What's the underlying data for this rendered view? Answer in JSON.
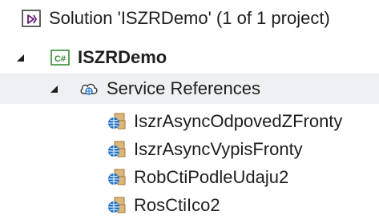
{
  "solution": {
    "label": "Solution 'ISZRDemo' (1 of 1 project)",
    "icon": "solution-icon"
  },
  "project": {
    "label": "ISZRDemo",
    "icon": "csharp-project-icon",
    "expanded": true
  },
  "service_references": {
    "label": "Service References",
    "icon": "service-references-icon",
    "expanded": true
  },
  "references": [
    {
      "label": "IszrAsyncOdpovedZFronty",
      "icon": "service-reference-icon"
    },
    {
      "label": "IszrAsyncVypisFronty",
      "icon": "service-reference-icon"
    },
    {
      "label": "RobCtiPodleUdaju2",
      "icon": "service-reference-icon"
    },
    {
      "label": "RosCtiIco2",
      "icon": "service-reference-icon"
    }
  ],
  "colors": {
    "selection_background": "#eef0f3",
    "text": "#1e1e1e",
    "solution_icon": "#68217a",
    "csharp_icon": "#388a34",
    "folder_yellow": "#dcb67a",
    "globe_blue": "#1e70c8"
  }
}
